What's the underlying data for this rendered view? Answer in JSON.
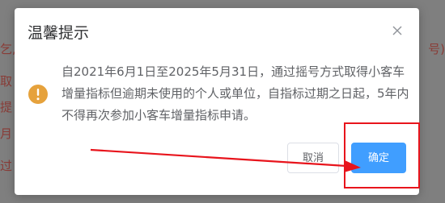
{
  "background": {
    "left_fragments": [
      "乞,",
      "取",
      "提",
      "月",
      "",
      "过"
    ],
    "right_fragment": "号)"
  },
  "dialog": {
    "title": "温馨提示",
    "message": "自2021年6月1日至2025年5月31日，通过摇号方式取得小客车增量指标但逾期未使用的个人或单位，自指标过期之日起，5年内不得再次参加小客车增量指标申请。",
    "cancel_label": "取消",
    "confirm_label": "确定",
    "close_icon": "close-icon",
    "warning_icon": "warning-icon"
  },
  "colors": {
    "primary": "#409eff",
    "warning": "#e6a23c",
    "annotation": "#e8141c",
    "overlay": "#7f7f7f"
  }
}
